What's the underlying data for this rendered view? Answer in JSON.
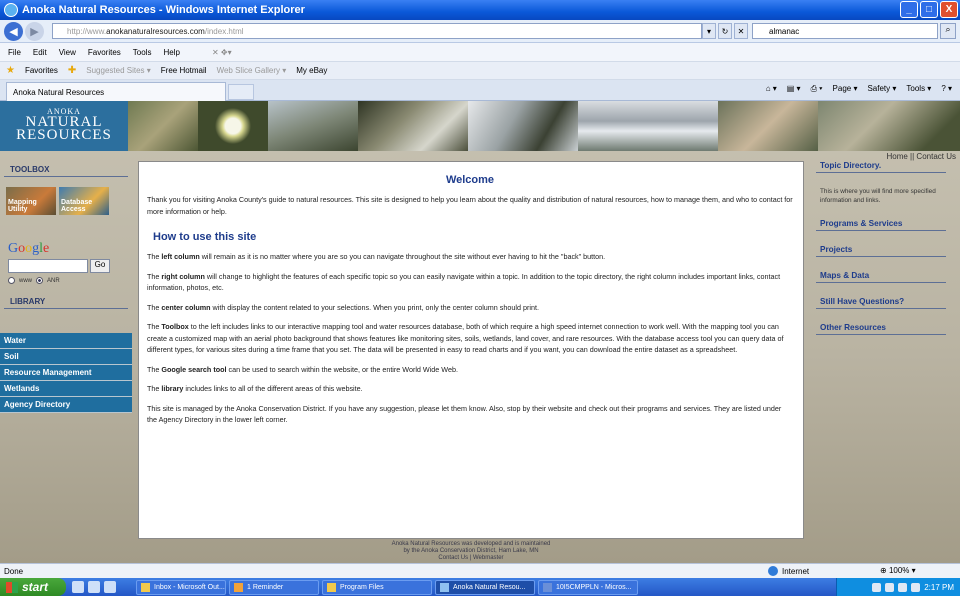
{
  "window": {
    "title": "Anoka Natural Resources - Windows Internet Explorer",
    "controls": {
      "minimize": "_",
      "maximize": "□",
      "close": "X"
    }
  },
  "address": {
    "url_host": "http://www.",
    "url_main": "anokanaturalresources.com",
    "url_path": "/index.html",
    "search_value": "almanac"
  },
  "menu": [
    "File",
    "Edit",
    "View",
    "Favorites",
    "Tools",
    "Help"
  ],
  "favorites": {
    "label": "Favorites",
    "items": [
      "Suggested Sites ▾",
      "Free Hotmail",
      "Web Slice Gallery ▾",
      "My eBay"
    ]
  },
  "tab": {
    "label": "Anoka Natural Resources"
  },
  "commandbar": [
    "Page ▾",
    "Safety ▾",
    "Tools ▾"
  ],
  "site": {
    "logo_line1": "ANOKA",
    "logo_line2": "NATURAL",
    "logo_line3": "RESOURCES",
    "top_links": "Home || Contact Us",
    "toolbox_heading": "TOOLBOX",
    "tool_mapping": "Mapping Utility",
    "tool_database": "Database Access",
    "google_search_button": "Go",
    "radio_web": "www",
    "radio_site": "ANR",
    "library_heading": "LIBRARY",
    "library_items": [
      "Water",
      "Soil",
      "Resource Management",
      "Wetlands",
      "Agency Directory"
    ]
  },
  "center": {
    "title": "Welcome",
    "intro": "Thank you for visiting Anoka County's guide to natural resources. This site is designed to help you learn about the quality and distribution of natural resources, how to manage them, and who to contact for more information or help.",
    "howto_heading": "How to use this site",
    "p1_bold": "left column",
    "p1_rest": " will remain as it is no matter where you are so you can navigate throughout the site without ever having to hit the \"back\" button.",
    "p2_bold": "right column",
    "p2_rest": " will change to highlight the features of each specific topic so you can easily navigate within a topic. In addition to the topic directory, the right column includes important links, contact information, photos, etc.",
    "p3_bold": "center column",
    "p3_rest": " with display the content related to your selections. When you print, only the center column should print.",
    "p4_bold": "Toolbox",
    "p4_rest": " to the left includes links to our interactive mapping tool and water resources database, both of which require a high speed internet connection to work well. With the mapping tool you can create a customized map with an aerial photo background that shows features like monitoring sites, soils, wetlands, land cover, and rare resources. With the database access tool you can query data of different types, for various sites during a time frame that you set. The data will be presented in easy to read charts and if you want, you can download the entire dataset as a spreadsheet.",
    "p5_bold": "Google search tool",
    "p5_rest": " can be used to search within the website, or the entire World Wide Web.",
    "p6_bold": "library",
    "p6_rest": " includes links to all of the different areas of this website.",
    "p7": "This site is managed by the Anoka Conservation District. If you have any suggestion, please let them know. Also, stop by their website and check out their programs and services. They are listed under the Agency Directory in the lower left corner.",
    "the": "The",
    "footer1": "Anoka Natural Resources was developed and is maintained",
    "footer2": "by the Anoka Conservation District, Ham Lake, MN",
    "footer3": "Contact Us | Webmaster"
  },
  "right": {
    "topic_heading": "Topic Directory.",
    "topic_text": "This is where you will find more specified information and links.",
    "links": [
      "Programs & Services",
      "Projects",
      "Maps & Data",
      "Still Have Questions?",
      "Other Resources"
    ]
  },
  "status": {
    "left": "Done",
    "zone": "Internet",
    "zoom": "100%"
  },
  "taskbar": {
    "start": "start",
    "tasks": [
      "Inbox - Microsoft Out...",
      "1 Reminder",
      "Program Files",
      "Anoka Natural Resou...",
      "10I5CMPPLN - Micros..."
    ],
    "clock": "2:17 PM"
  },
  "colors": {
    "library_bg": "#1f6e9f",
    "heading_blue": "#1e3c8c",
    "logo_bg": "#2c6f9e"
  }
}
